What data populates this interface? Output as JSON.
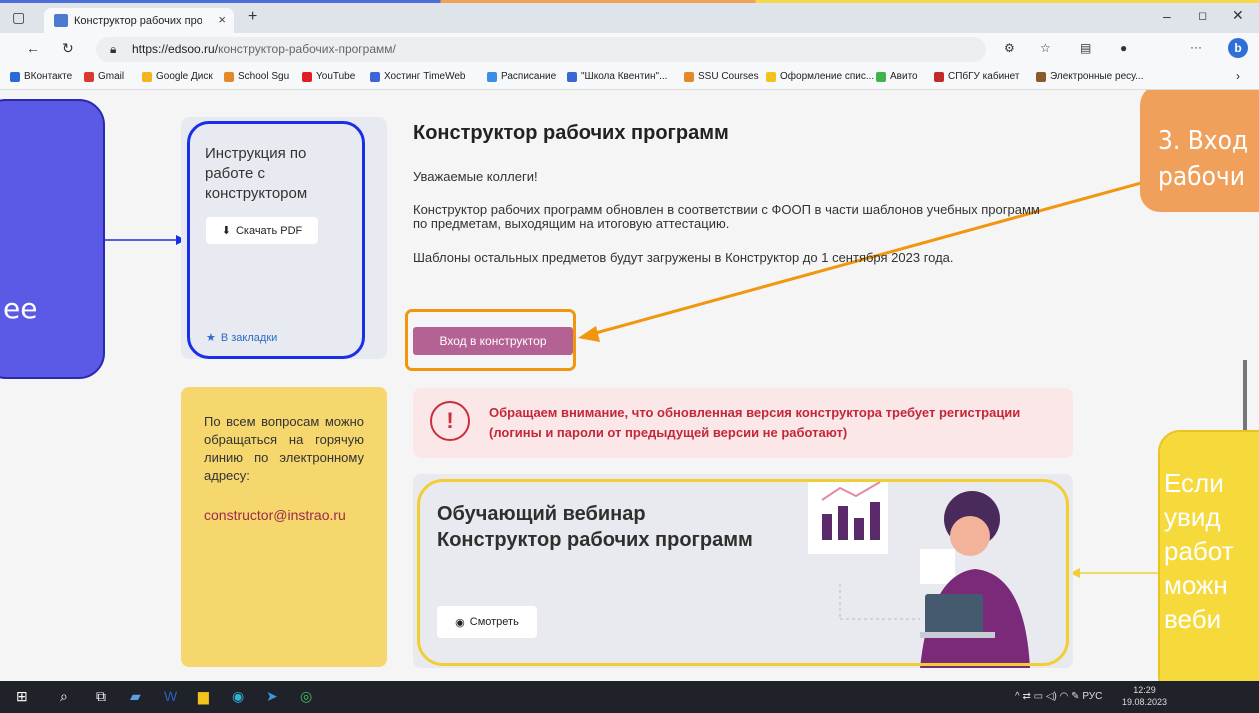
{
  "browser": {
    "tab_title": "Конструктор рабочих програм",
    "url_host": "https://edsoo.ru/",
    "url_path": "конструктор-рабочих-программ/",
    "bookmarks": [
      "ВКонтакте",
      "Gmail",
      "Google Диск",
      "School Sgu",
      "YouTube",
      "Хостинг TimeWeb",
      "Расписание",
      "\"Школа Квентин\"...",
      "SSU Courses",
      "Оформление спис...",
      "Авито",
      "СПбГУ кабинет",
      "Электронные ресу..."
    ]
  },
  "sidebar": {
    "instruction_title": "Инструкция по работе с конструктором",
    "download_label": "Скачать PDF",
    "bookmark_label": "В закладки",
    "contact_text": "По всем вопросам можно обращаться на горячую линию по электронному адресу:",
    "contact_email": "constructor@instrao.ru"
  },
  "main": {
    "title": "Конструктор рабочих программ",
    "greeting": "Уважаемые коллеги!",
    "paragraph1": "Конструктор рабочих программ обновлен в соответствии с ФООП в части шаблонов учебных программ по предметам, выходящим на итоговую аттестацию.",
    "paragraph2": "Шаблоны остальных предметов будут загружены в Конструктор до 1 сентября 2023 года.",
    "enter_label": "Вход в конструктор",
    "alert_text": "Обращаем внимание, что обновленная версия конструктора требует регистрации (логины и пароли от предыдущей версии не работают)",
    "alert_icon": "!",
    "webinar_line1": "Обучающий вебинар",
    "webinar_line2": "Конструктор рабочих программ",
    "watch_label": "Смотреть"
  },
  "overlays": {
    "left_text": "ее",
    "orange_line1": "3. Вход",
    "orange_line2": "рабочи",
    "yellow_lines": [
      "Если",
      "увид",
      "работ",
      "можн",
      "веби"
    ]
  },
  "taskbar": {
    "lang": "РУС",
    "time": "12:29",
    "date": "19.08.2023"
  },
  "colors": {
    "accent_blue": "#1a2ee8",
    "orange": "#f0960f",
    "yellow": "#f1cf34",
    "enter_button": "#b46293"
  }
}
